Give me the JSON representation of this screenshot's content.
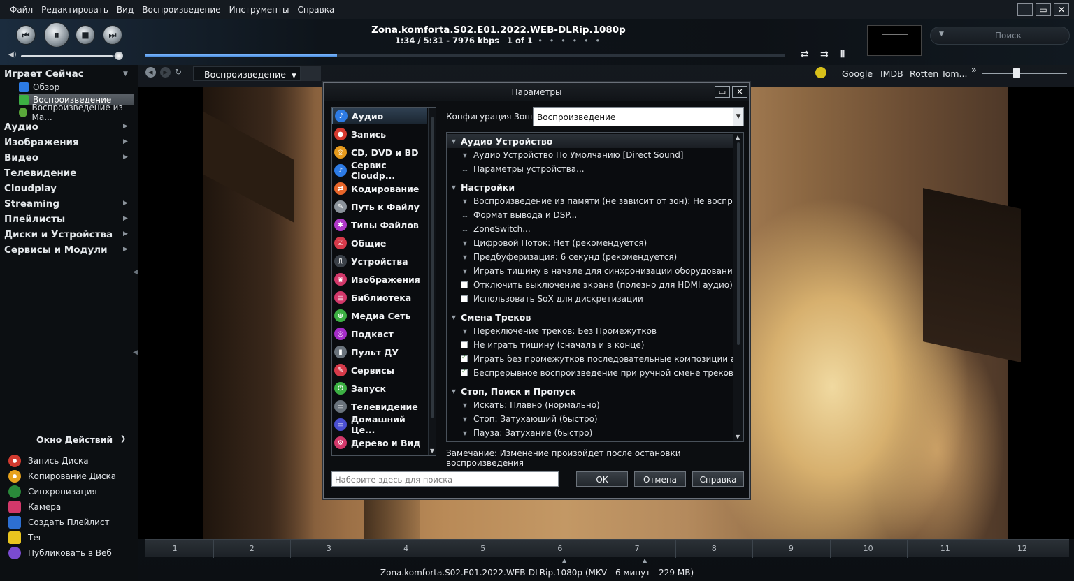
{
  "menu": [
    "Файл",
    "Редактировать",
    "Вид",
    "Воспроизведение",
    "Инструменты",
    "Справка"
  ],
  "player": {
    "track_name": "Zona.komforta.S02.E01.2022.WEB-DLRip.1080p",
    "time": "1:34 / 5:31 - 7976 kbps",
    "count": "1 of 1",
    "dots": "• • • • • •",
    "progress": 0.3,
    "volume": 0.92,
    "search_placeholder": "Поиск"
  },
  "sidebar": {
    "playing_now": "Играет Сейчас",
    "sub_items": [
      "Обзор",
      "Воспроизведение",
      "Воспроизведение из Ma..."
    ],
    "items": [
      "Аудио",
      "Изображения",
      "Видео",
      "Телевидение",
      "Cloudplay",
      "Streaming",
      "Плейлисты",
      "Диски и Устройства",
      "Сервисы и Модули"
    ],
    "actions_header": "Окно Действий",
    "actions": [
      "Запись Диска",
      "Копирование Диска",
      "Синхронизация",
      "Камера",
      "Создать Плейлист",
      "Tег",
      "Публиковать в Веб"
    ]
  },
  "view": {
    "tab_label": "Воспроизведение",
    "links": [
      "Google",
      "IMDB",
      "Rotten Tom..."
    ],
    "more": "»"
  },
  "seek_labels": [
    "1",
    "2",
    "3",
    "4",
    "5",
    "6",
    "7",
    "8",
    "9",
    "10",
    "11",
    "12"
  ],
  "status": "Zona.komforta.S02.E01.2022.WEB-DLRip.1080p (MKV - 6 минут - 229 MB)",
  "dialog": {
    "title": "Параметры",
    "categories": [
      "Аудио",
      "Запись",
      "CD, DVD и BD",
      "Сервис Cloudp...",
      "Кодирование",
      "Путь к Файлу",
      "Типы Файлов",
      "Общие",
      "Устройства",
      "Изображения",
      "Библиотека",
      "Медиа Сеть",
      "Подкаст",
      "Пульт ДУ",
      "Сервисы",
      "Запуск",
      "Телевидение",
      "Домашний Це...",
      "Дерево и Вид"
    ],
    "zone_label": "Конфигурация Зоны:",
    "zone_value": "Воспроизведение",
    "settings": [
      {
        "type": "hdr",
        "text": "Аудио Устройство"
      },
      {
        "type": "item",
        "mark": "tri",
        "text": "Аудио Устройство По Умолчанию [Direct Sound]"
      },
      {
        "type": "item",
        "mark": "dots",
        "text": "Параметры устройства..."
      },
      {
        "type": "hdr",
        "text": "Настройки"
      },
      {
        "type": "item",
        "mark": "tri",
        "text": "Воспроизведение из памяти (не зависит от зон): Не воспроизвод..."
      },
      {
        "type": "item",
        "mark": "dots",
        "text": "Формат вывода и DSP..."
      },
      {
        "type": "item",
        "mark": "dots",
        "text": "ZoneSwitch..."
      },
      {
        "type": "item",
        "mark": "tri",
        "text": "Цифровой Поток: Нет (рекомендуется)"
      },
      {
        "type": "item",
        "mark": "tri",
        "text": "Предбуферизация: 6 секунд (рекомендуется)"
      },
      {
        "type": "item",
        "mark": "tri",
        "text": "Играть тишину в начале для синхронизации оборудования: Нет"
      },
      {
        "type": "item",
        "mark": "cb",
        "checked": false,
        "text": "Отключить выключение экрана (полезно для HDMI аудио)"
      },
      {
        "type": "item",
        "mark": "cb",
        "checked": false,
        "text": "Использовать SoX для дискретизации"
      },
      {
        "type": "hdr",
        "text": "Смена Треков"
      },
      {
        "type": "item",
        "mark": "tri",
        "text": "Переключение треков: Без Промежутков"
      },
      {
        "type": "item",
        "mark": "cb",
        "checked": false,
        "text": "Не играть тишину (сначала и в конце)"
      },
      {
        "type": "item",
        "mark": "cb",
        "checked": true,
        "text": "Играть без промежутков последовательные композиции альбо..."
      },
      {
        "type": "item",
        "mark": "cb",
        "checked": true,
        "text": "Беспрерывное воспроизведение при ручной смене треков"
      },
      {
        "type": "hdr",
        "text": "Стоп, Поиск и Пропуск"
      },
      {
        "type": "item",
        "mark": "tri",
        "text": "Искать: Плавно (нормально)"
      },
      {
        "type": "item",
        "mark": "tri",
        "text": "Стоп: Затухающий (быстро)"
      },
      {
        "type": "item",
        "mark": "tri",
        "text": "Пауза: Затухание (быстро)"
      }
    ],
    "note": "Замечание: Изменение произойдет после остановки воспроизведения",
    "search_placeholder": "Наберите здесь для поиска",
    "ok": "OK",
    "cancel": "Отмена",
    "help": "Справка"
  }
}
